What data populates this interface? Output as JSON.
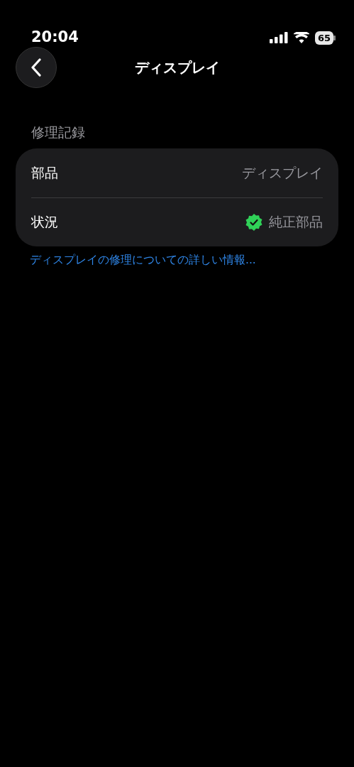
{
  "status_bar": {
    "time": "20:04",
    "battery": "65"
  },
  "nav": {
    "title": "ディスプレイ"
  },
  "section": {
    "header": "修理記録",
    "rows": [
      {
        "label": "部品",
        "value": "ディスプレイ",
        "kind": "text"
      },
      {
        "label": "状況",
        "value": "純正部品",
        "kind": "verified"
      }
    ],
    "link": "ディスプレイの修理についての詳しい情報..."
  }
}
